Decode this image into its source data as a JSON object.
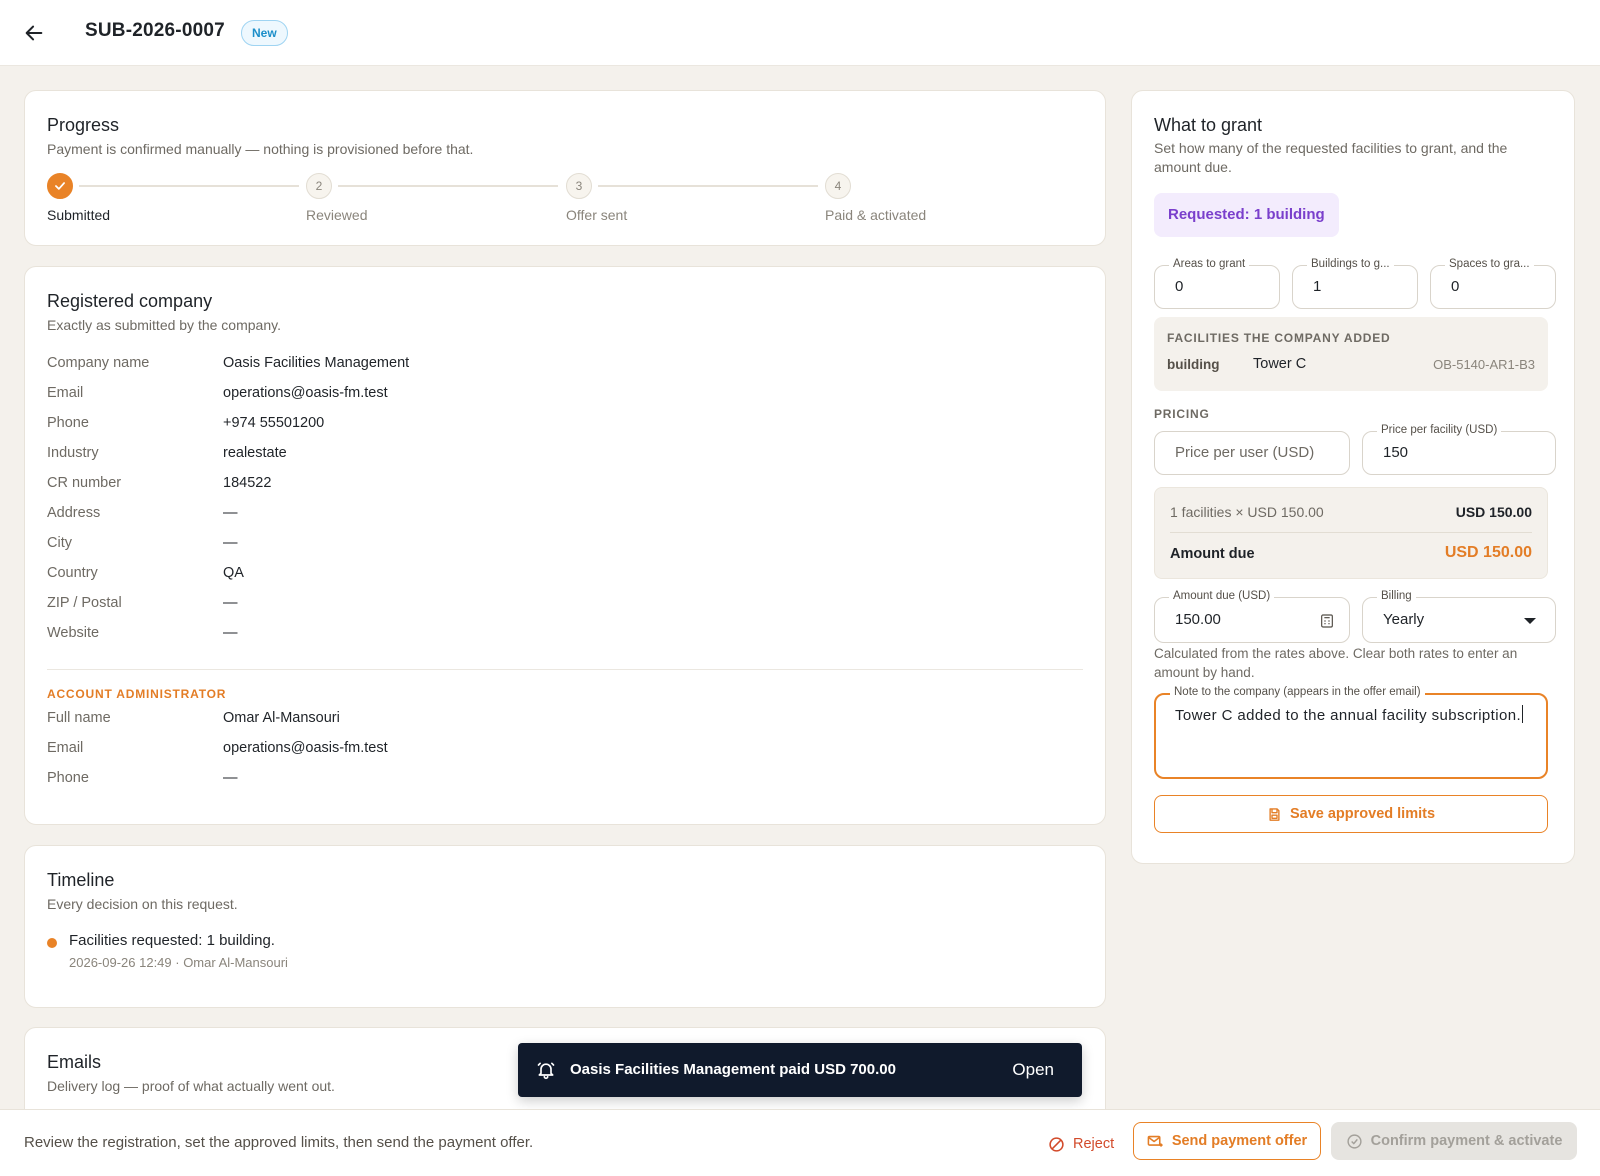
{
  "header": {
    "back_icon": "arrow-left-icon",
    "title": "SUB-2026-0007",
    "status_badge": "New"
  },
  "progress": {
    "title": "Progress",
    "subtitle": "Payment is confirmed manually — nothing is provisioned before that.",
    "steps": [
      {
        "number": "1",
        "label": "Submitted",
        "state": "done"
      },
      {
        "number": "2",
        "label": "Reviewed",
        "state": "pending"
      },
      {
        "number": "3",
        "label": "Offer sent",
        "state": "pending"
      },
      {
        "number": "4",
        "label": "Paid & activated",
        "state": "pending"
      }
    ]
  },
  "company": {
    "title": "Registered company",
    "subtitle": "Exactly as submitted by the company.",
    "rows": [
      {
        "key": "Company name",
        "value": "Oasis Facilities Management"
      },
      {
        "key": "Email",
        "value": "operations@oasis-fm.test"
      },
      {
        "key": "Phone",
        "value": "+974 55501200"
      },
      {
        "key": "Industry",
        "value": "realestate"
      },
      {
        "key": "CR number",
        "value": "184522"
      },
      {
        "key": "Address",
        "value": "—"
      },
      {
        "key": "City",
        "value": "—"
      },
      {
        "key": "Country",
        "value": "QA"
      },
      {
        "key": "ZIP / Postal",
        "value": "—"
      },
      {
        "key": "Website",
        "value": "—"
      }
    ],
    "admin_section_label": "ACCOUNT ADMINISTRATOR",
    "admin_rows": [
      {
        "key": "Full name",
        "value": "Omar Al-Mansouri"
      },
      {
        "key": "Email",
        "value": "operations@oasis-fm.test"
      },
      {
        "key": "Phone",
        "value": "—"
      }
    ]
  },
  "timeline": {
    "title": "Timeline",
    "subtitle": "Every decision on this request.",
    "items": [
      {
        "text": "Facilities requested: 1 building.",
        "meta": "2026-09-26 12:49 · Omar Al-Mansouri"
      }
    ]
  },
  "emails": {
    "title": "Emails",
    "subtitle": "Delivery log — proof of what actually went out."
  },
  "grant": {
    "title": "What to grant",
    "subtitle": "Set how many of the requested facilities to grant, and the amount due.",
    "requested_chip": "Requested: 1 building",
    "counts": [
      {
        "label": "Areas to grant",
        "value": "0"
      },
      {
        "label": "Buildings to g...",
        "value": "1"
      },
      {
        "label": "Spaces to gra...",
        "value": "0"
      }
    ],
    "facilities": {
      "title": "FACILITIES THE COMPANY ADDED",
      "items": [
        {
          "type": "building",
          "name": "Tower C",
          "code": "OB-5140-AR1-B3"
        }
      ]
    },
    "pricing_label": "PRICING",
    "price_per_user_placeholder": "Price per user (USD)",
    "price_per_facility_label": "Price per facility (USD)",
    "price_per_facility_value": "150",
    "calc_line": "1 facilities × USD 150.00",
    "calc_line_value": "USD 150.00",
    "amount_due_label": "Amount due",
    "amount_due_value": "USD 150.00",
    "amount_due_field_label": "Amount due (USD)",
    "amount_due_field_value": "150.00",
    "billing_label": "Billing",
    "billing_value": "Yearly",
    "helper_text": "Calculated from the rates above. Clear both rates to enter an amount by hand.",
    "note_label": "Note to the company (appears in the offer email)",
    "note_value": "Tower C added to the annual facility subscription.",
    "save_button": "Save approved limits"
  },
  "toast": {
    "icon": "bell-ring-icon",
    "message": "Oasis Facilities Management paid USD 700.00",
    "action": "Open"
  },
  "footer": {
    "hint": "Review the registration, set the approved limits, then send the payment offer.",
    "reject_label": "Reject",
    "send_label": "Send payment offer",
    "confirm_label": "Confirm payment & activate"
  },
  "colors": {
    "accent": "#e98327",
    "badge": "#1d8fc9",
    "chip": "#7a3fcc",
    "danger": "#d24a2a",
    "toast_bg": "#101a2c"
  }
}
